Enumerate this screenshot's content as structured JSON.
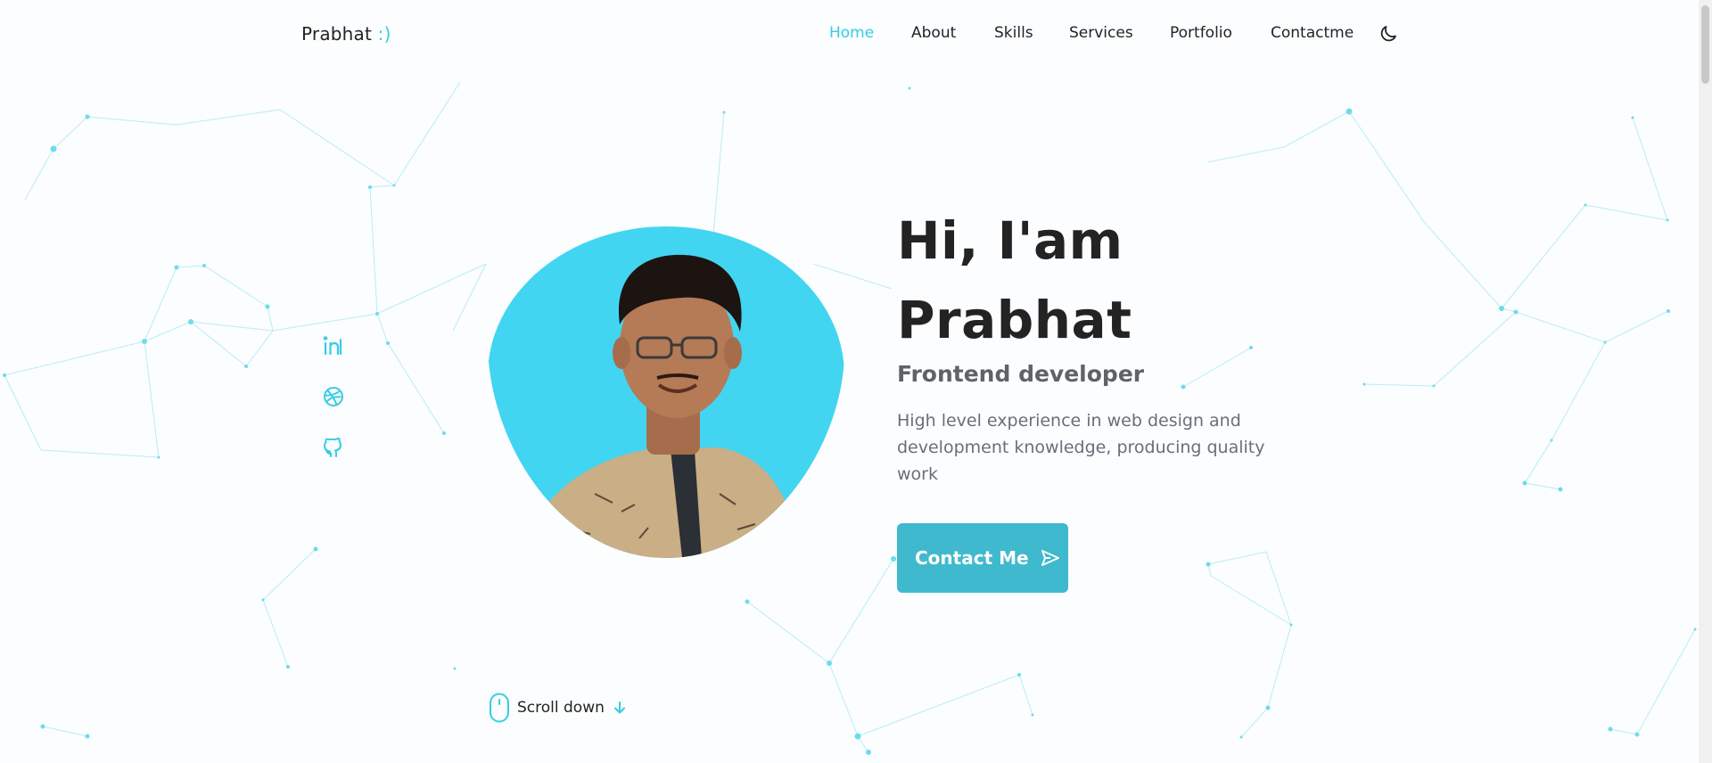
{
  "header": {
    "logo_name": "Prabhat",
    "logo_smile": ":)",
    "nav": [
      {
        "label": "Home",
        "active": true
      },
      {
        "label": "About",
        "active": false
      },
      {
        "label": "Skills",
        "active": false
      },
      {
        "label": "Services",
        "active": false
      },
      {
        "label": "Portfolio",
        "active": false
      },
      {
        "label": "Contactme",
        "active": false
      }
    ],
    "theme_icon": "moon-icon"
  },
  "social": [
    {
      "icon": "linkedin-icon"
    },
    {
      "icon": "dribbble-icon"
    },
    {
      "icon": "github-icon"
    }
  ],
  "hero": {
    "title_line1": "Hi, I'am",
    "title_line2": "Prabhat",
    "subtitle": "Frontend developer",
    "description": "High level experience in web design and development knowledge, producing quality work",
    "contact_button": "Contact Me",
    "contact_icon": "send-icon"
  },
  "scroll": {
    "label": "Scroll down",
    "mouse_icon": "mouse-icon",
    "arrow_icon": "arrow-down-icon"
  },
  "colors": {
    "accent": "#36cde3",
    "blob": "#42d5f2",
    "button": "#3fb9cd",
    "text": "#232323",
    "muted": "#66707a"
  }
}
